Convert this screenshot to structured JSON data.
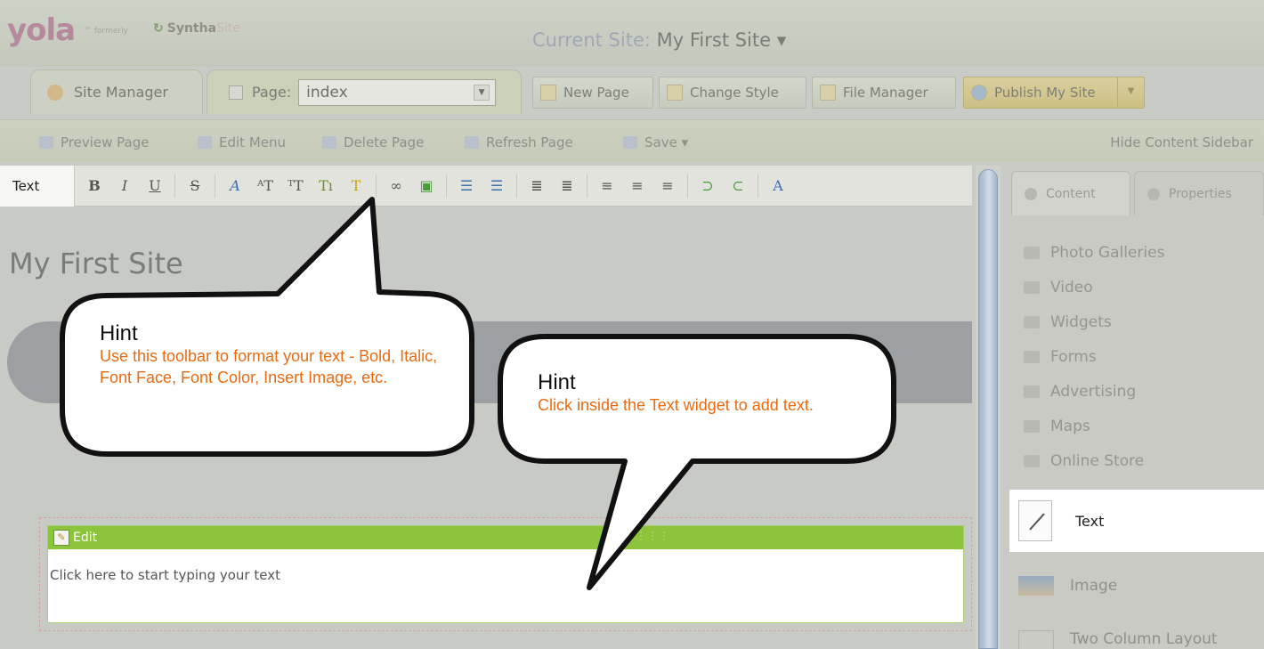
{
  "header": {
    "logo": "yola",
    "logo_tm": "™",
    "formerly": "formerly",
    "synthasite_prefix": "Syntha",
    "synthasite_suffix": "Site",
    "current_site_label": "Current Site:",
    "current_site_name": "My First Site ▾"
  },
  "tabs": {
    "site_manager": "Site Manager",
    "page_label": "Page:",
    "page_value": "index"
  },
  "buttons": {
    "new_page": "New Page",
    "change_style": "Change Style",
    "file_manager": "File Manager",
    "publish": "Publish My Site"
  },
  "secondary_toolbar": {
    "preview": "Preview Page",
    "edit_menu": "Edit Menu",
    "delete": "Delete Page",
    "refresh": "Refresh Page",
    "save": "Save ▾",
    "hide_sidebar": "Hide Content Sidebar"
  },
  "format_toolbar": {
    "label": "Text",
    "icons": [
      "bold-icon",
      "italic-icon",
      "underline-icon",
      "strikethrough-icon",
      "font-face-icon",
      "font-size-increase-icon",
      "font-size-icon",
      "font-color-icon",
      "highlight-icon",
      "link-icon",
      "insert-image-icon",
      "ordered-list-icon",
      "unordered-list-icon",
      "outdent-icon",
      "indent-icon",
      "align-left-icon",
      "align-center-icon",
      "align-right-icon",
      "undo-icon",
      "redo-icon",
      "clean-icon"
    ]
  },
  "editor": {
    "site_title": "My First Site",
    "widget_edit_label": "Edit",
    "widget_placeholder": "Click here to start typing your text"
  },
  "sidebar": {
    "tab_content": "Content",
    "tab_properties": "Properties",
    "items": [
      "Photo Galleries",
      "Video",
      "Widgets",
      "Forms",
      "Advertising",
      "Maps",
      "Online Store"
    ],
    "widget_text": "Text",
    "widget_image": "Image",
    "widget_two_column": "Two Column Layout"
  },
  "hints": {
    "hint1": {
      "title": "Hint",
      "body": "Use this toolbar to format your text  -  Bold, Italic, Font Face, Font Color, Insert Image, etc."
    },
    "hint2": {
      "title": "Hint",
      "body": "Click inside the Text widget to add text."
    }
  },
  "colors": {
    "hint_text": "#e86b12",
    "widget_header": "#8cc43c",
    "logo": "#b58a9c"
  }
}
